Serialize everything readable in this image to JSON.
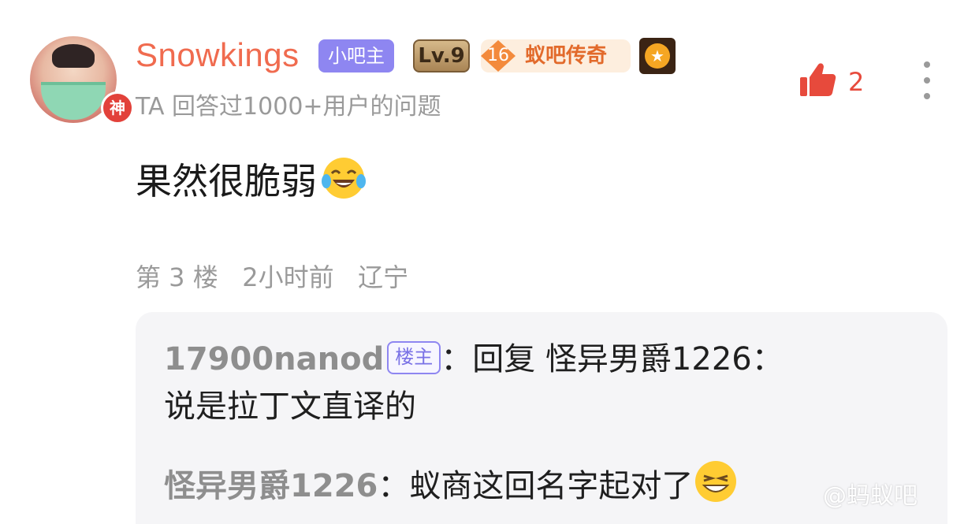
{
  "comment": {
    "username": "Snowkings",
    "avatar_badge": "神",
    "tags": {
      "admin": "小吧主",
      "level": "Lv.9",
      "legend_num": "16",
      "legend_text": "蚁吧传奇"
    },
    "subtitle": "TA 回答过1000+用户的问题",
    "like_count": "2",
    "content_text": "果然很脆弱",
    "meta": "第 3 楼   2小时前   辽宁"
  },
  "replies": [
    {
      "name": "17900nanod",
      "op_tag": "楼主",
      "separator": "：",
      "line1_text": "回复 怪异男爵1226：",
      "line2_text": "说是拉丁文直译的"
    },
    {
      "name": "怪异男爵1226",
      "separator": "：",
      "text": "蚁商这回名字起对了"
    }
  ],
  "watermark": "@蚂蚁吧",
  "icons": {
    "like": "thumbs-up-icon",
    "more": "more-vertical-icon",
    "emoji_laugh": "tears-of-joy-emoji",
    "emoji_grin": "grinning-emoji"
  },
  "colors": {
    "username": "#f06b4f",
    "like": "#e74a3c",
    "admin_tag": "#8e86f1",
    "reply_bg": "#f5f5f7"
  }
}
